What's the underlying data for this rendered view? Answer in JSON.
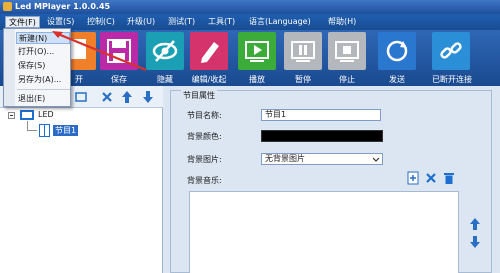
{
  "window": {
    "title": "Led MPlayer 1.0.0.45"
  },
  "menubar": {
    "items": [
      "文件(F)",
      "设置(S)",
      "控制(C)",
      "升级(U)",
      "测试(T)",
      "工具(T)",
      "语言(Language)",
      "帮助(H)"
    ]
  },
  "file_menu": {
    "items": [
      "新建(N)",
      "打开(O)...",
      "保存(S)",
      "另存为(A)...",
      "退出(E)"
    ]
  },
  "toolbar": {
    "labels": [
      "开",
      "保存",
      "隐藏",
      "编辑/收起",
      "播放",
      "暂停",
      "停止",
      "发送",
      "已断开连接"
    ]
  },
  "tree": {
    "root": "LED",
    "child": "节目1"
  },
  "properties": {
    "group_title": "节目属性",
    "name_label": "节目名称:",
    "name_value": "节目1",
    "bgcolor_label": "背景颜色:",
    "bgimage_label": "背景图片:",
    "bgimage_value": "无背景图片",
    "bgmusic_label": "背景音乐:"
  },
  "colors": {
    "titlebar": "#1f4f9c",
    "arrow": "#d9302a"
  }
}
